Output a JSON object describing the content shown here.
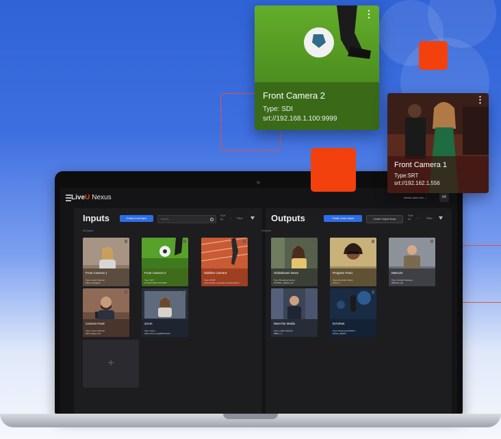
{
  "app": {
    "brand_prefix": "Live",
    "brand_u": "U",
    "brand_suffix": "Nexus",
    "account": "liveuiu-demo-inc",
    "avatar_initials": "AB"
  },
  "inputs": {
    "title": "Inputs",
    "create_button": "Create a new input",
    "search_placeholder": "Search...",
    "sort_label": "Sort by",
    "filter_label": "Filter",
    "subtitle": "All types",
    "cards": [
      {
        "name": "Front Camera 1",
        "info": "Type: LiveU Channel\nMeet_Instagram",
        "theme": "#6e5e4f"
      },
      {
        "name": "Front Camera 2",
        "info": "Type: SRT\nsrt://192.168.1.100:9999",
        "theme": "#4f7f24"
      },
      {
        "name": "Sideline Camera",
        "info": "Type: RTMP\nrtmp://stream.example.com/live/stream",
        "theme": "#b14a2a"
      },
      {
        "name": "Camera Feed",
        "info": "Type: LiveU Channel\nMain Stage Cam",
        "theme": "#5a4136"
      },
      {
        "name": "Zoom",
        "info": "Type: Zoom\nhttps://zoom.us/j/843572222",
        "theme": "#2d3544"
      }
    ],
    "add_label": "+"
  },
  "outputs": {
    "title": "Outputs",
    "create_button": "Create a new output",
    "group_button": "Create Output Group",
    "sort_label": "Sort by",
    "filter_label": "Filter",
    "subtitle": "Outputs",
    "cards": [
      {
        "name": "Globalnews News",
        "info": "Type: Broadcast Server\nGLOBAL_NEWS_HD",
        "theme": "#4b5446"
      },
      {
        "name": "Program Feed",
        "info": "Type: Decoder Output\nLiveU 1",
        "theme": "#7a6a48"
      },
      {
        "name": "Metro24",
        "info": "Type: Vertical Streamer\nMETRO_HD",
        "theme": "#5c5f66"
      },
      {
        "name": "Meet the Media",
        "info": "Type: Cable Network\nMEET_3",
        "theme": "#3b4252"
      },
      {
        "name": "EchoNet",
        "info": "Type: Streaming Platform\nECHO_NEWS",
        "theme": "#1f3550"
      }
    ]
  },
  "floating": {
    "card1": {
      "name": "Front Camera 2",
      "type": "Type: SDI",
      "url": "srt://192.168.1.100:9999"
    },
    "card2": {
      "name": "Front Camera 1",
      "type": "Type:SRT",
      "url": "srt://192.162.1.556"
    }
  },
  "colors": {
    "accent": "#f3410e",
    "primary_button": "#2f6ee8",
    "background_blue": "#3e6fe0"
  }
}
